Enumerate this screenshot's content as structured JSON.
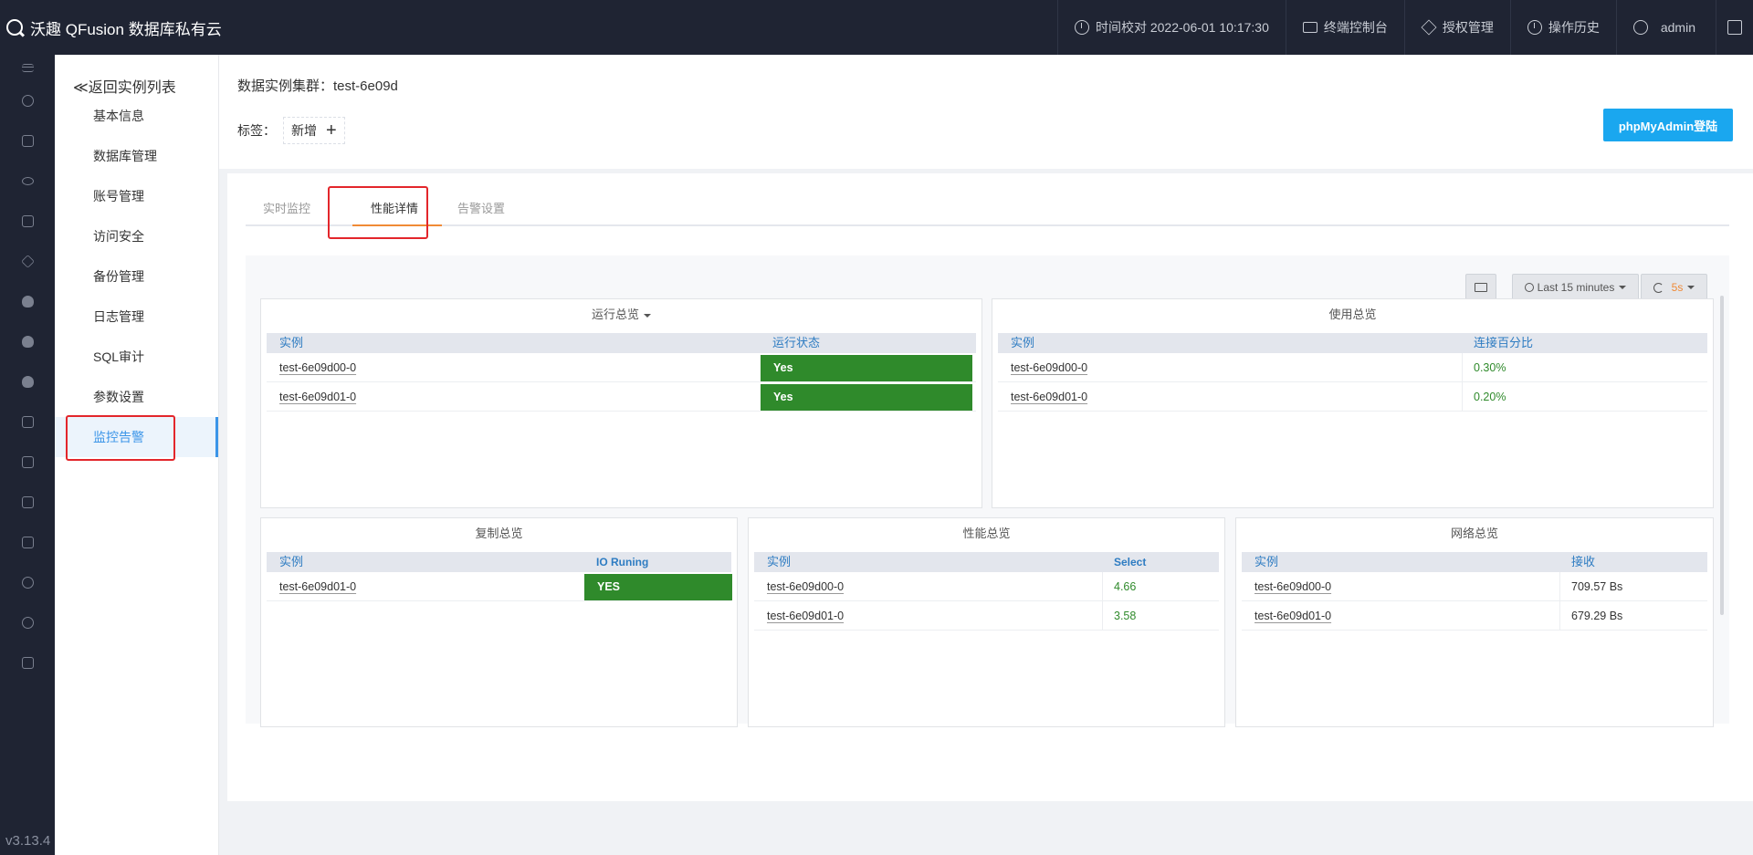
{
  "app": {
    "brand": "沃趣 QFusion 数据库私有云",
    "time_sync": "时间校对 2022-06-01 10:17:30",
    "terminal": "终端控制台",
    "license": "授权管理",
    "history": "操作历史",
    "user": "admin",
    "version": "v3.13.4"
  },
  "subnav": {
    "back": "≪返回实例列表",
    "items": [
      "基本信息",
      "数据库管理",
      "账号管理",
      "访问安全",
      "备份管理",
      "日志管理",
      "SQL审计",
      "参数设置",
      "监控告警"
    ],
    "active_index": 8
  },
  "header": {
    "cluster_label": "数据实例集群：test-6e09d",
    "tag_label": "标签：",
    "tag_add": "新增",
    "phpmyadmin": "phpMyAdmin登陆"
  },
  "tabs": [
    "实时监控",
    "性能详情",
    "告警设置"
  ],
  "active_tab": 1,
  "toolbar": {
    "time_range": "Last 15 minutes",
    "refresh": "5s"
  },
  "panels": {
    "run": {
      "title": "运行总览",
      "headers": [
        "实例",
        "运行状态"
      ],
      "rows": [
        [
          "test-6e09d00-0",
          "Yes"
        ],
        [
          "test-6e09d01-0",
          "Yes"
        ]
      ]
    },
    "usage": {
      "title": "使用总览",
      "headers": [
        "实例",
        "连接百分比"
      ],
      "rows": [
        [
          "test-6e09d00-0",
          "0.30%"
        ],
        [
          "test-6e09d01-0",
          "0.20%"
        ]
      ]
    },
    "repl": {
      "title": "复制总览",
      "headers": [
        "实例",
        "IO Runing"
      ],
      "rows": [
        [
          "test-6e09d01-0",
          "YES"
        ]
      ]
    },
    "perf": {
      "title": "性能总览",
      "headers": [
        "实例",
        "Select"
      ],
      "rows": [
        [
          "test-6e09d00-0",
          "4.66"
        ],
        [
          "test-6e09d01-0",
          "3.58"
        ]
      ]
    },
    "net": {
      "title": "网络总览",
      "headers": [
        "实例",
        "接收"
      ],
      "rows": [
        [
          "test-6e09d00-0",
          "709.57 Bs"
        ],
        [
          "test-6e09d01-0",
          "679.29 Bs"
        ]
      ]
    }
  },
  "colors": {
    "topbar": "#1f2433",
    "accent": "#3b95e8",
    "button": "#1aa7ef",
    "ok_green": "#2f8a2b",
    "tab_ink": "#f08a36",
    "highlight_red": "#e3262b"
  }
}
